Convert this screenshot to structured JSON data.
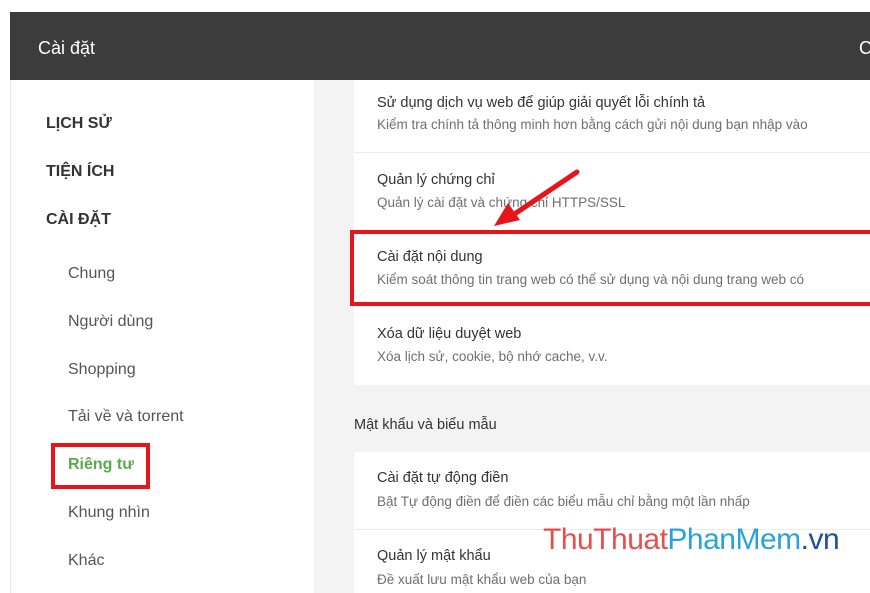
{
  "window": {
    "title": "Cài đặt",
    "edge_glyph": "C"
  },
  "sidebar": {
    "sections": [
      {
        "label": "LỊCH SỬ"
      },
      {
        "label": "TIỆN ÍCH"
      },
      {
        "label": "CÀI ĐẶT"
      }
    ],
    "items": [
      {
        "label": "Chung"
      },
      {
        "label": "Người dùng"
      },
      {
        "label": "Shopping"
      },
      {
        "label": "Tải về và torrent"
      },
      {
        "label": "Riêng tư",
        "active": true
      },
      {
        "label": "Khung nhìn"
      },
      {
        "label": "Khác"
      }
    ]
  },
  "privacy_card": {
    "rows": [
      {
        "title": "Sử dụng dịch vụ web để giúp giải quyết lỗi chính tả",
        "desc": "Kiểm tra chính tả thông minh hơn bằng cách gửi nội dung bạn nhập vào"
      },
      {
        "title": "Quản lý chứng chỉ",
        "desc": "Quản lý cài đặt và chứng chỉ HTTPS/SSL"
      },
      {
        "title": "Cài đặt nội dung",
        "desc": "Kiểm soát thông tin trang web có thể sử dụng và nội dung trang web có"
      },
      {
        "title": "Xóa dữ liệu duyệt web",
        "desc": "Xóa lịch sử, cookie, bộ nhớ cache, v.v."
      }
    ]
  },
  "passwords": {
    "heading": "Mật khẩu và biểu mẫu",
    "rows": [
      {
        "title": "Cài đặt tự động điền",
        "desc": "Bật Tự động điền để điền các biểu mẫu chỉ bằng một lần nhấp"
      },
      {
        "title": "Quản lý mật khẩu",
        "desc": "Đề xuất lưu mật khẩu web của bạn"
      }
    ]
  },
  "watermark": {
    "part1": "ThuThuat",
    "part2": "PhanMem",
    "part3": ".vn"
  },
  "colors": {
    "titlebar": "#3c3c3c",
    "active_item": "#5ba84d",
    "highlight": "#e8141b",
    "content_bg": "#f3f3f3"
  }
}
